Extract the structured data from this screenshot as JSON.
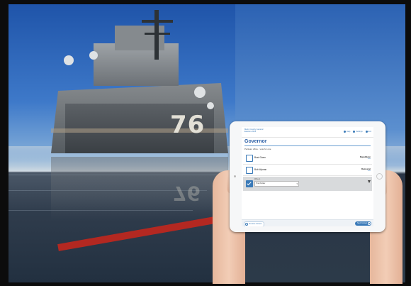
{
  "ballot": {
    "org_line1": "Marin County General",
    "org_line2": "Election 2016",
    "header_links": [
      "Help",
      "Settings",
      "Exit"
    ],
    "title": "Governor",
    "pager": "",
    "instruction": "Partisan office - vote for one",
    "candidates": [
      {
        "name": "Brad Owen",
        "party": "Republican",
        "party_sub": "Vote"
      },
      {
        "name": "Bob Wyman",
        "party": "Democrat",
        "party_sub": "Vote"
      }
    ],
    "writein": {
      "label": "Write-in",
      "value": "Tina Parker",
      "checked": true
    },
    "mid_text": "",
    "footer": {
      "back_label": "Previous Contest",
      "next_label": "Next Contest"
    }
  },
  "photo": {
    "hull_number": "76"
  },
  "colors": {
    "accent": "#3a7ab8",
    "title": "#2a5ea5"
  }
}
